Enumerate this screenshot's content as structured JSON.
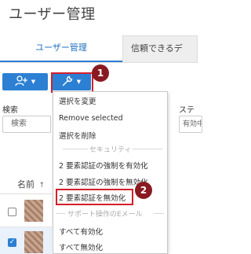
{
  "header": {
    "title": "ユーザー管理"
  },
  "tabs": [
    {
      "label": "ユーザー管理",
      "active": true
    },
    {
      "label": "信頼できるデ",
      "active": false
    }
  ],
  "toolbar": {
    "add_user_icon": "add-user-icon",
    "tools_icon": "wrench-icon",
    "badge_1": "1",
    "badge_2": "2"
  },
  "filters": {
    "search_label": "検索",
    "search_placeholder": "検索",
    "status_label": "ステー",
    "status_value": "有効中の"
  },
  "table": {
    "name_header": "名前",
    "sort_indicator": "↑"
  },
  "menu": {
    "items": [
      "選択を変更",
      "Remove selected",
      "選択を削除"
    ],
    "section_security": "セキュリティ",
    "security_items": [
      "2 要素認証の強制を有効化",
      "2 要素認証の強制を無効化",
      "2 要素認証を無効化"
    ],
    "section_email": "サポート操作のEメール",
    "email_items": [
      "すべて有効化",
      "すべて無効化"
    ]
  },
  "colors": {
    "accent": "#2c80d3",
    "highlight": "#d41f2a",
    "badge": "#8a1a21"
  }
}
